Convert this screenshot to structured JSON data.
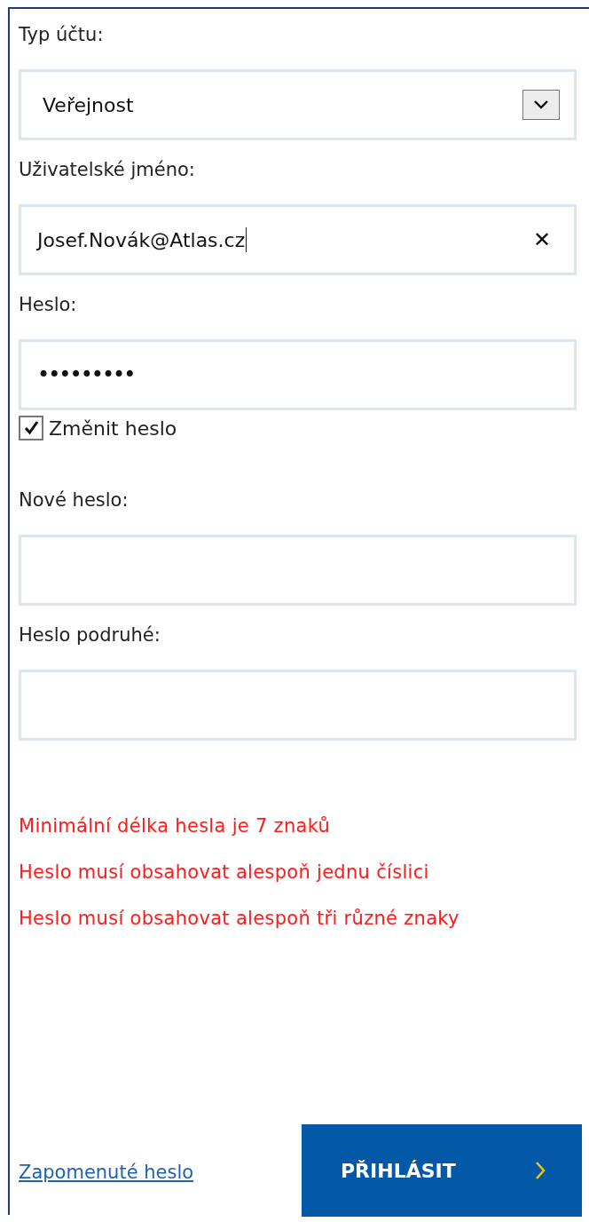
{
  "fields": [
    {
      "kind": "select",
      "label": "Typ účtu:",
      "value": "Veřejnost"
    },
    {
      "kind": "text",
      "label": "Uživatelské jméno:",
      "value": "Josef.Novák@Atlas.cz",
      "focused": true,
      "clearable": true,
      "clear_icon": "✕"
    },
    {
      "kind": "password",
      "label": "Heslo:",
      "value": "•••••••••"
    },
    {
      "kind": "checkbox",
      "label": "Změnit heslo",
      "checked": true
    },
    {
      "kind": "password",
      "label": "Nové heslo:"
    },
    {
      "kind": "password",
      "label": "Heslo podruhé:"
    }
  ],
  "errors": [
    "Minimální délka hesla je 7 znaků",
    "Heslo musí obsahovat alespoň jednu číslici",
    "Heslo musí obsahovat alespoň tři různé znaky"
  ],
  "forgot_link": "Zapomenuté heslo",
  "submit_button": {
    "label": "PŘIHLÁSIT"
  }
}
